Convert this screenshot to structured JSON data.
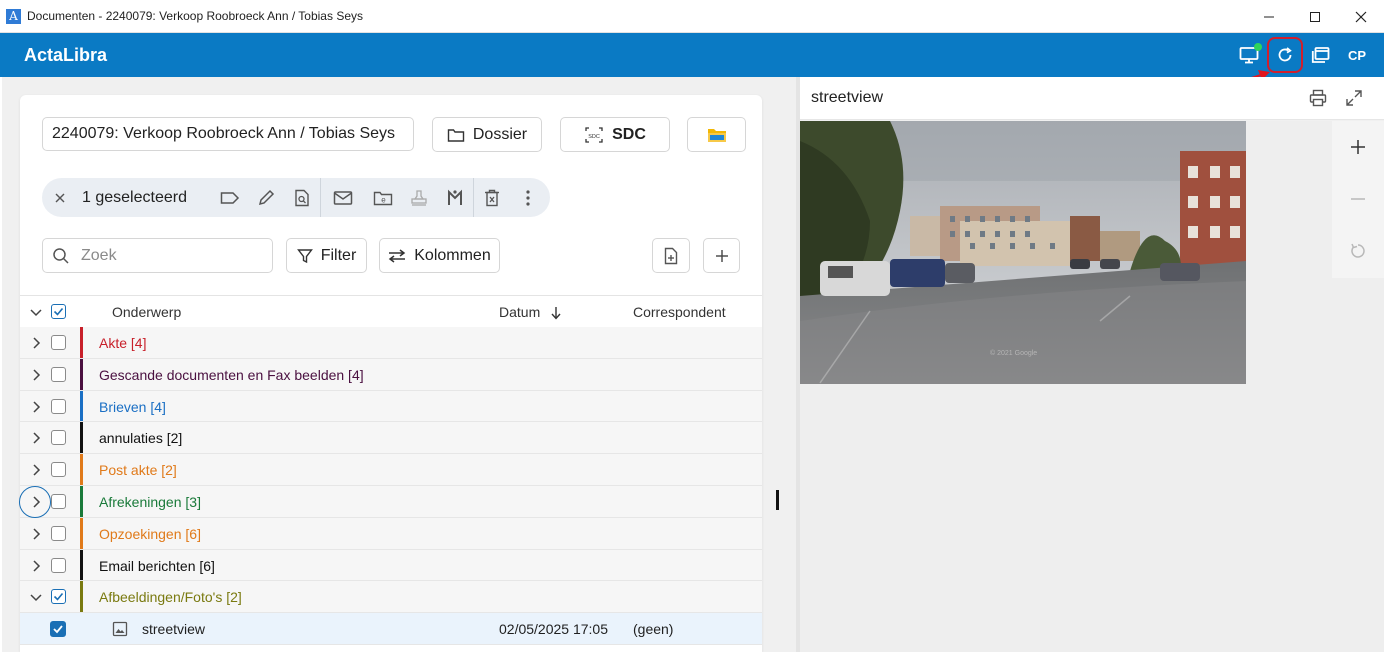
{
  "window": {
    "title": "Documenten - 2240079: Verkoop Roobroeck Ann / Tobias Seys",
    "app_icon_letter": "A"
  },
  "appbar": {
    "brand": "ActaLibra",
    "user_initials": "CP",
    "colors": {
      "primary": "#0a7ac4",
      "status": "#2fd45a",
      "highlight": "#d21f2c"
    }
  },
  "dossier": {
    "value": "2240079: Verkoop Roobroeck Ann / Tobias Seys",
    "dossier_button": "Dossier",
    "sdc_button": "SDC",
    "sdc_badge": "SDC"
  },
  "selection": {
    "count_label": "1 geselecteerd"
  },
  "toolbar": {
    "search_placeholder": "Zoek",
    "filter_label": "Filter",
    "columns_label": "Kolommen"
  },
  "table": {
    "headers": {
      "subject": "Onderwerp",
      "date": "Datum",
      "correspondent": "Correspondent"
    },
    "groups": [
      {
        "label": "Akte [4]",
        "color": "#c8202a",
        "expanded": false,
        "checked": false
      },
      {
        "label": "Gescande documenten en Fax beelden [4]",
        "color": "#4a1040",
        "expanded": false,
        "checked": false
      },
      {
        "label": "Brieven [4]",
        "color": "#1a6fc4",
        "expanded": false,
        "checked": false
      },
      {
        "label": "annulaties [2]",
        "color": "#111111",
        "expanded": false,
        "checked": false
      },
      {
        "label": "Post akte [2]",
        "color": "#e07a1a",
        "expanded": false,
        "checked": false
      },
      {
        "label": "Afrekeningen [3]",
        "color": "#1a7a3a",
        "expanded": false,
        "checked": false
      },
      {
        "label": "Opzoekingen [6]",
        "color": "#e07a1a",
        "expanded": false,
        "checked": false
      },
      {
        "label": "Email berichten [6]",
        "color": "#111111",
        "expanded": false,
        "checked": false
      },
      {
        "label": "Afbeeldingen/Foto's [2]",
        "color": "#7a7a10",
        "expanded": true,
        "checked": true
      }
    ],
    "child_row": {
      "name": "streetview",
      "date": "02/05/2025 17:05",
      "correspondent": "(geen)",
      "checked": true
    }
  },
  "preview": {
    "title": "streetview",
    "watermark": "© 2021 Google"
  }
}
